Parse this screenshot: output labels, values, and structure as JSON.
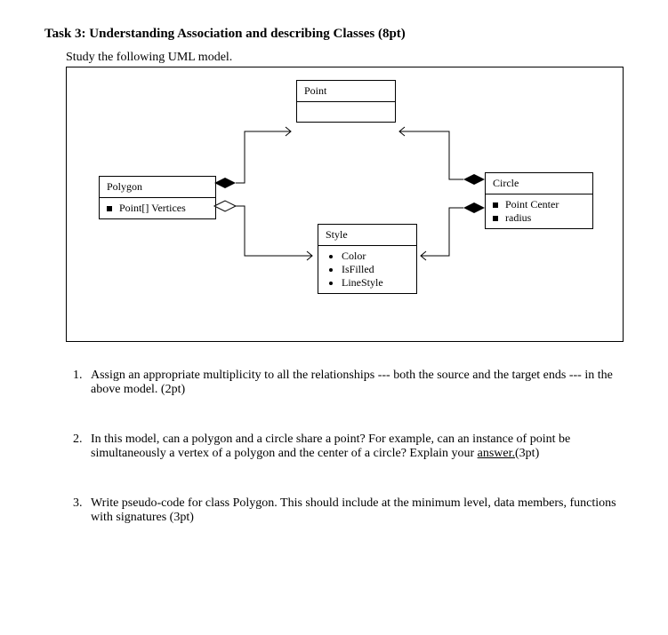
{
  "task_title": "Task 3:  Understanding Association and describing Classes (8pt)",
  "study_line": "Study the following UML model.",
  "classes": {
    "point": {
      "name": "Point"
    },
    "polygon": {
      "name": "Polygon",
      "attr1": "Point[] Vertices"
    },
    "circle": {
      "name": "Circle",
      "attr1": "Point Center",
      "attr2": "radius"
    },
    "style": {
      "name": "Style",
      "a1": "Color",
      "a2": "IsFilled",
      "a3": "LineStyle"
    }
  },
  "q1_a": "Assign an appropriate multiplicity to all the relationships --- both the source and the target ends --- in the above model. (2pt)",
  "q2_a": "In this model, can a polygon and a circle share a point?  For example, can an instance of point be simultaneously a vertex of a polygon and the center of a circle?  Explain your ",
  "q2_u": "answer.",
  "q2_b": "(3pt)",
  "q3_a": "Write pseudo-code for class Polygon. This should include at the minimum level, data members, functions with signatures (3pt)"
}
